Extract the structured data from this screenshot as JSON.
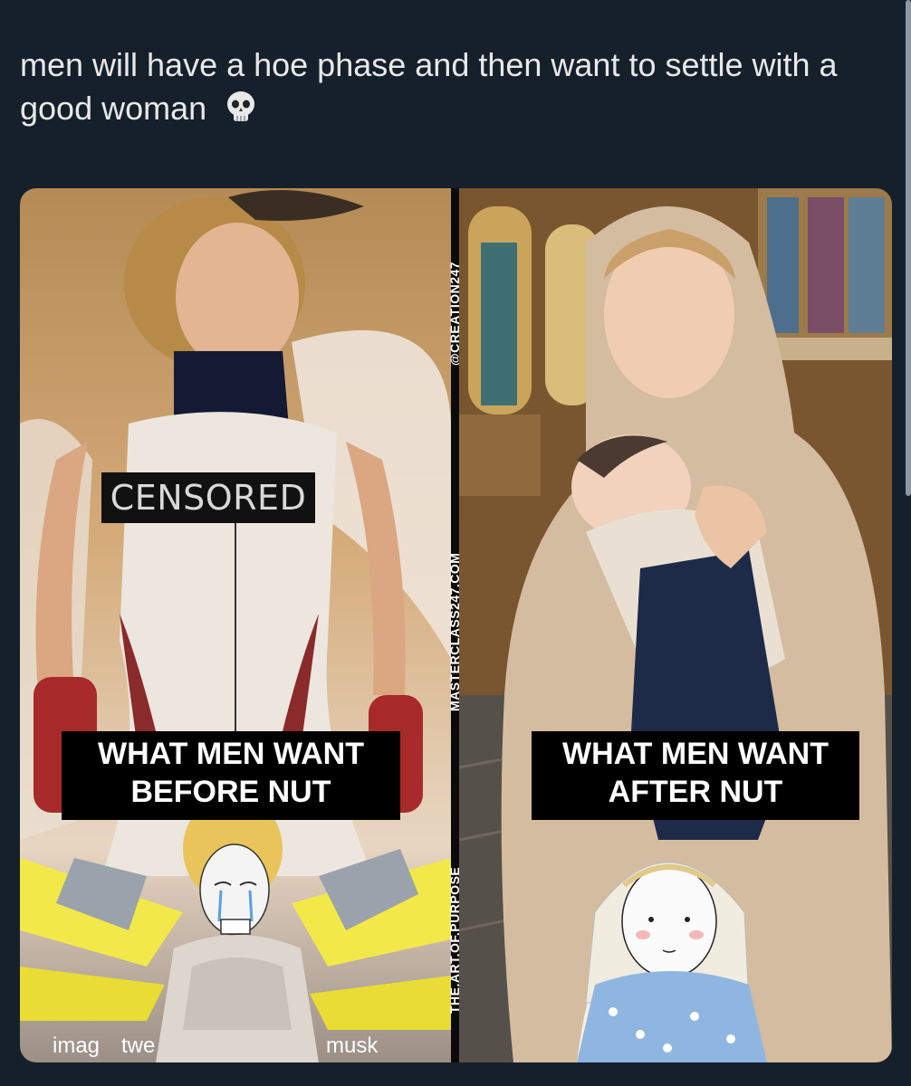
{
  "tweet": {
    "text": "men will have a hoe phase and then want to settle with a good woman"
  },
  "meme": {
    "left": {
      "censored_label": "CENSORED",
      "caption_line1": "WHAT MEN WANT",
      "caption_line2": "BEFORE NUT",
      "watermark_left": "imag",
      "watermark_mid": "twe",
      "watermark_right": "musk"
    },
    "right": {
      "caption_line1": "WHAT MEN WANT",
      "caption_line2": "AFTER NUT"
    },
    "side_labels": {
      "top": "@CREATION247",
      "middle": "MASTERCLASS247.COM",
      "bottom": "THE.ART.OF.PURPOSE"
    }
  }
}
